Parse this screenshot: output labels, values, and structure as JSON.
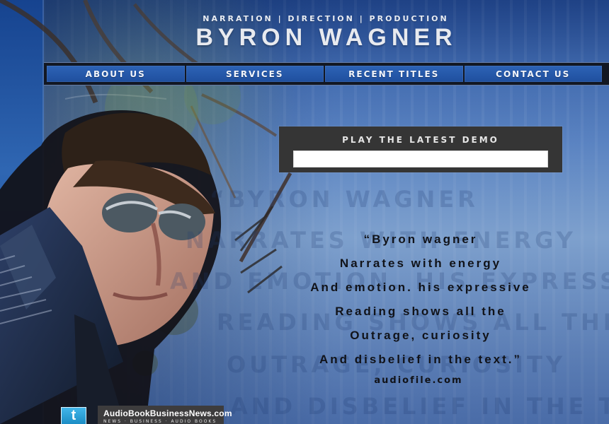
{
  "header": {
    "tagline": "Narration | Direction | Production",
    "name": "BYRON WAGNER"
  },
  "nav": {
    "items": [
      "About us",
      "Services",
      "Recent titles",
      "Contact us"
    ]
  },
  "demo": {
    "title": "Play the latest demo"
  },
  "quote": {
    "lines": [
      "“Byron Wagner",
      "narrates with energy",
      "and emotion. His expressive",
      "reading shows all the",
      "outrage, curiosity",
      "and disbelief in the text.”"
    ],
    "source": "Audiofile.com"
  },
  "footer": {
    "badge_main": "AudioBookBusinessNews.com",
    "badge_sub": "news · business · audio books",
    "social_icon": "twitter-icon"
  },
  "colors": {
    "accent": "#2d63b6",
    "demo_bg": "#353535",
    "header_text": "#e8eaef"
  }
}
